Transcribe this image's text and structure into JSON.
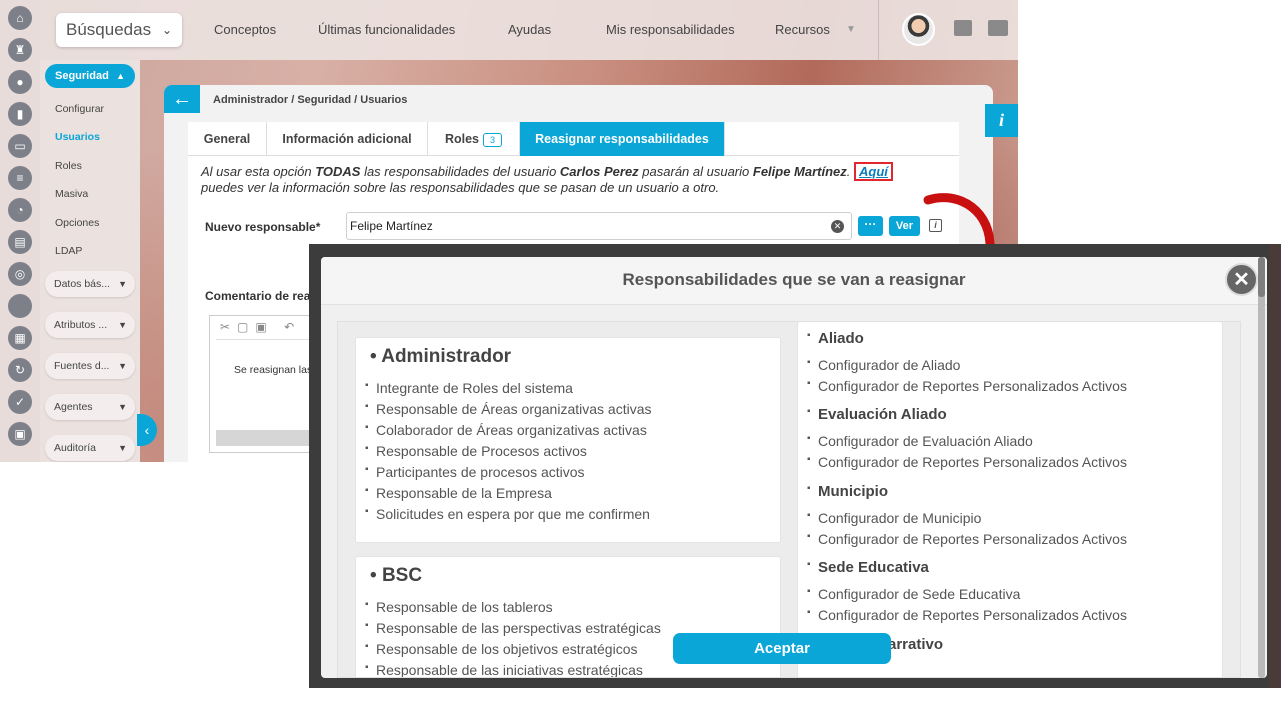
{
  "topbar": {
    "search_label": "Búsquedas",
    "nav": [
      "Conceptos",
      "Últimas funcionalidades",
      "Ayudas",
      "Mis responsabilidades",
      "Recursos"
    ]
  },
  "sidebar": {
    "section": "Seguridad",
    "subitems": [
      "Configurar",
      "Usuarios",
      "Roles",
      "Masiva",
      "Opciones",
      "LDAP"
    ],
    "groups": [
      "Datos bás...",
      "Atributos ...",
      "Fuentes d...",
      "Agentes",
      "Auditoría"
    ]
  },
  "breadcrumb": "Administrador / Seguridad / Usuarios",
  "tabs": {
    "general": "General",
    "info": "Información adicional",
    "roles": "Roles",
    "roles_count": "3",
    "reassign": "Reasignar responsabilidades"
  },
  "form": {
    "desc_1": "Al usar esta opción ",
    "desc_todas": "TODAS",
    "desc_2": " las responsabilidades del usuario ",
    "desc_from": "Carlos Perez",
    "desc_3": " pasarán al usuario ",
    "desc_to": "Felipe Martínez",
    "desc_4": ". ",
    "desc_link": "Aquí",
    "desc_5": "puedes ver la información sobre las responsabilidades que se pasan de un usuario a otro.",
    "nuevo_label": "Nuevo responsable*",
    "nuevo_value": "Felipe Martínez",
    "ver_label": "Ver",
    "coment_label": "Comentario de rea",
    "editor_text": "Se reasignan las"
  },
  "modal": {
    "title": "Responsabilidades que se van a reasignar",
    "accept": "Aceptar",
    "left_cards": [
      {
        "title": "Administrador",
        "items": [
          "Integrante de Roles del sistema",
          "Responsable de Áreas organizativas activas",
          "Colaborador de Áreas organizativas activas",
          "Responsable de Procesos activos",
          "Participantes de procesos activos",
          "Responsable de la Empresa",
          "Solicitudes en espera por que me confirmen"
        ]
      },
      {
        "title": "BSC",
        "items": [
          "Responsable de los tableros",
          "Responsable de las perspectivas estratégicas",
          "Responsable de los objetivos estratégicos",
          "Responsable de las iniciativas estratégicas"
        ]
      }
    ],
    "right_sections": [
      {
        "title": "Aliado",
        "items": [
          "Configurador de Aliado",
          "Configurador de Reportes Personalizados Activos"
        ]
      },
      {
        "title": "Evaluación Aliado",
        "items": [
          "Configurador de Evaluación Aliado",
          "Configurador de Reportes Personalizados Activos"
        ]
      },
      {
        "title": "Municipio",
        "items": [
          "Configurador de Municipio",
          "Configurador de Reportes Personalizados Activos"
        ]
      },
      {
        "title": "Sede Educativa",
        "items": [
          "Configurador de Sede Educativa",
          "Configurador de Reportes Personalizados Activos"
        ]
      },
      {
        "title": "Informe Narrativo",
        "items": []
      }
    ]
  },
  "colors": {
    "accent": "#0aa6d8",
    "highlight": "#e3262d",
    "arrow": "#c81010"
  }
}
